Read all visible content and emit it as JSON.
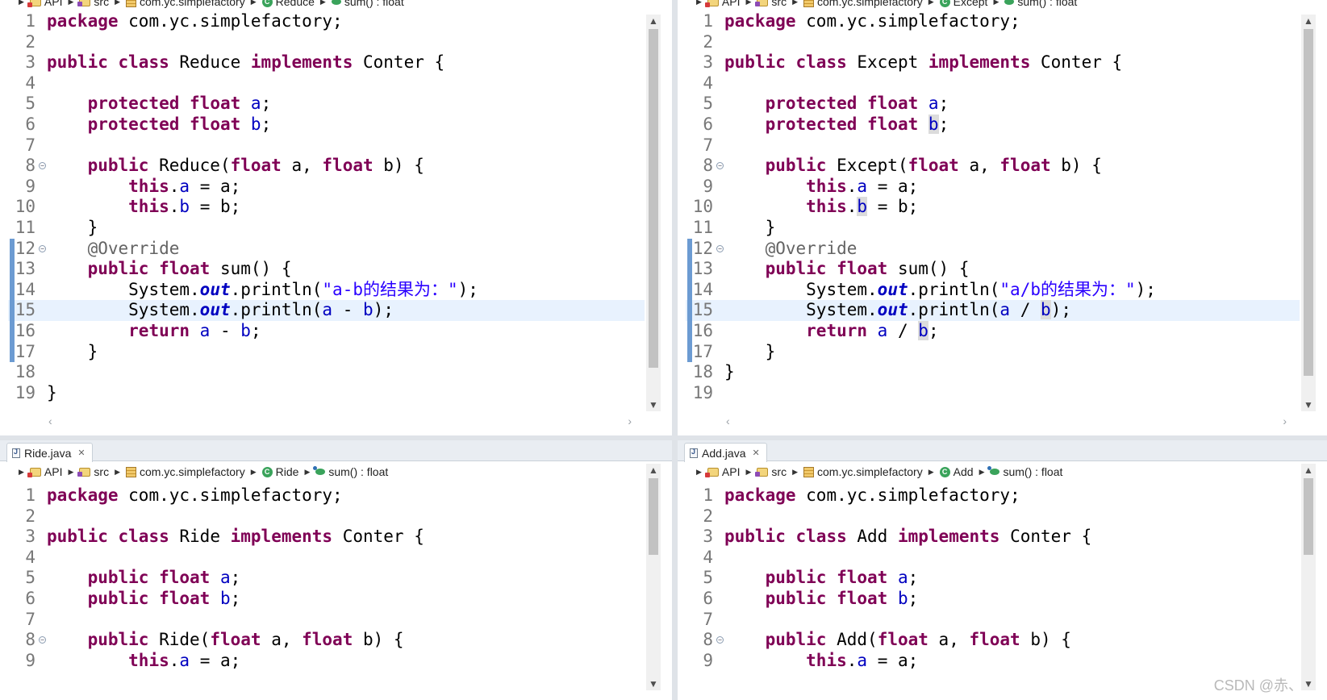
{
  "panes": {
    "top_left": {
      "breadcrumb": {
        "project": "API",
        "folder": "src",
        "package": "com.yc.simplefactory",
        "class": "Reduce",
        "method": "sum() : float"
      },
      "first_line": 1,
      "current_line": 15,
      "class_name": "Reduce",
      "field_modifier": "protected",
      "op": "-",
      "message": "\"a-b的结果为：\"",
      "last_line_code": "}"
    },
    "top_right": {
      "breadcrumb": {
        "project": "API",
        "folder": "src",
        "package": "com.yc.simplefactory",
        "class": "Except",
        "method": "sum() : float"
      },
      "first_line": 1,
      "current_line": 15,
      "class_name": "Except",
      "field_modifier": "protected",
      "op": "/",
      "message": "\"a/b的结果为：\""
    },
    "bottom_left": {
      "tab": "Ride.java",
      "breadcrumb": {
        "project": "API",
        "folder": "src",
        "package": "com.yc.simplefactory",
        "class": "Ride",
        "method": "sum() : float"
      },
      "class_name": "Ride",
      "field_modifier": "public"
    },
    "bottom_right": {
      "tab": "Add.java",
      "breadcrumb": {
        "project": "API",
        "folder": "src",
        "package": "com.yc.simplefactory",
        "class": "Add",
        "method": "sum() : float"
      },
      "class_name": "Add",
      "field_modifier": "public"
    }
  },
  "code_text": {
    "package_kw": "package",
    "package_name": " com.yc.simplefactory;",
    "public_kw": "public",
    "class_kw": "class",
    "implements_kw": "implements",
    "interface": "Conter",
    "open_brace": " {",
    "close_brace": "}",
    "float_kw": "float",
    "this_kw": "this",
    "return_kw": "return",
    "override": "@Override",
    "system": "System.",
    "out": "out",
    "println": ".println(",
    "sum_sig": " sum() {"
  },
  "watermark": "CSDN @赤、"
}
